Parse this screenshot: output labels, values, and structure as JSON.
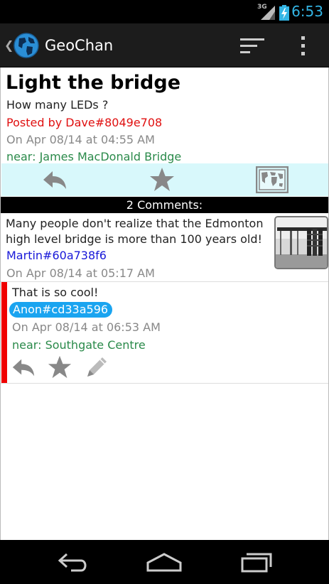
{
  "status_bar": {
    "network": "3G",
    "time": "6:53"
  },
  "app_bar": {
    "title": "GeoChan"
  },
  "post": {
    "title": "Light the bridge",
    "body": "How many LEDs ?",
    "author": "Posted by Dave#8049e708",
    "date": "On Apr 08/14 at 04:55 AM",
    "location": "near: James MacDonald Bridge"
  },
  "comments_header": "2 Comments:",
  "comments": [
    {
      "text": "Many people don't realize that the Edmonton high level bridge is more than 100 years old!",
      "author": "Martin#60a738f6",
      "date": "On Apr 08/14 at 05:17 AM"
    },
    {
      "text": "That is so cool!",
      "author": "Anon#cd33a596",
      "date": "On Apr 08/14 at 06:53 AM",
      "location": "near: Southgate Centre"
    }
  ],
  "colors": {
    "accent": "#33b5e5",
    "author_red": "#e01010",
    "author_blue": "#1818d8",
    "location_green": "#2a8a4a",
    "actions_bg": "#d8f8fb",
    "highlight_bar": "#f00000",
    "badge_bg": "#1aa4f0"
  }
}
